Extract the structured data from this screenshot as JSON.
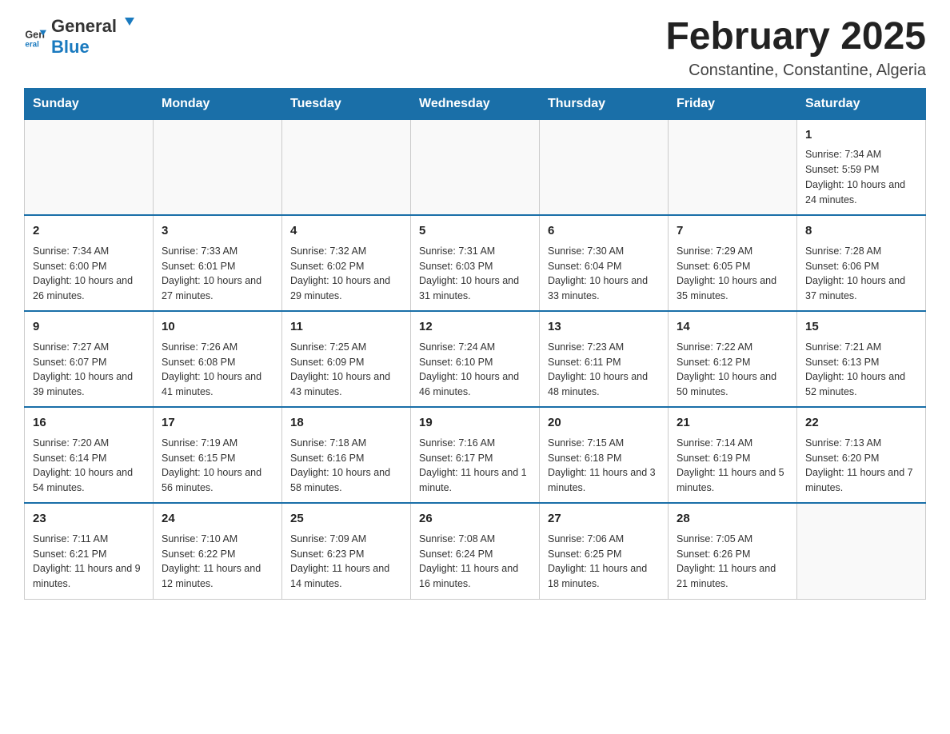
{
  "header": {
    "logo_general": "General",
    "logo_blue": "Blue",
    "month_year": "February 2025",
    "location": "Constantine, Constantine, Algeria"
  },
  "days_of_week": [
    "Sunday",
    "Monday",
    "Tuesday",
    "Wednesday",
    "Thursday",
    "Friday",
    "Saturday"
  ],
  "weeks": [
    [
      {
        "day": "",
        "info": ""
      },
      {
        "day": "",
        "info": ""
      },
      {
        "day": "",
        "info": ""
      },
      {
        "day": "",
        "info": ""
      },
      {
        "day": "",
        "info": ""
      },
      {
        "day": "",
        "info": ""
      },
      {
        "day": "1",
        "info": "Sunrise: 7:34 AM\nSunset: 5:59 PM\nDaylight: 10 hours and 24 minutes."
      }
    ],
    [
      {
        "day": "2",
        "info": "Sunrise: 7:34 AM\nSunset: 6:00 PM\nDaylight: 10 hours and 26 minutes."
      },
      {
        "day": "3",
        "info": "Sunrise: 7:33 AM\nSunset: 6:01 PM\nDaylight: 10 hours and 27 minutes."
      },
      {
        "day": "4",
        "info": "Sunrise: 7:32 AM\nSunset: 6:02 PM\nDaylight: 10 hours and 29 minutes."
      },
      {
        "day": "5",
        "info": "Sunrise: 7:31 AM\nSunset: 6:03 PM\nDaylight: 10 hours and 31 minutes."
      },
      {
        "day": "6",
        "info": "Sunrise: 7:30 AM\nSunset: 6:04 PM\nDaylight: 10 hours and 33 minutes."
      },
      {
        "day": "7",
        "info": "Sunrise: 7:29 AM\nSunset: 6:05 PM\nDaylight: 10 hours and 35 minutes."
      },
      {
        "day": "8",
        "info": "Sunrise: 7:28 AM\nSunset: 6:06 PM\nDaylight: 10 hours and 37 minutes."
      }
    ],
    [
      {
        "day": "9",
        "info": "Sunrise: 7:27 AM\nSunset: 6:07 PM\nDaylight: 10 hours and 39 minutes."
      },
      {
        "day": "10",
        "info": "Sunrise: 7:26 AM\nSunset: 6:08 PM\nDaylight: 10 hours and 41 minutes."
      },
      {
        "day": "11",
        "info": "Sunrise: 7:25 AM\nSunset: 6:09 PM\nDaylight: 10 hours and 43 minutes."
      },
      {
        "day": "12",
        "info": "Sunrise: 7:24 AM\nSunset: 6:10 PM\nDaylight: 10 hours and 46 minutes."
      },
      {
        "day": "13",
        "info": "Sunrise: 7:23 AM\nSunset: 6:11 PM\nDaylight: 10 hours and 48 minutes."
      },
      {
        "day": "14",
        "info": "Sunrise: 7:22 AM\nSunset: 6:12 PM\nDaylight: 10 hours and 50 minutes."
      },
      {
        "day": "15",
        "info": "Sunrise: 7:21 AM\nSunset: 6:13 PM\nDaylight: 10 hours and 52 minutes."
      }
    ],
    [
      {
        "day": "16",
        "info": "Sunrise: 7:20 AM\nSunset: 6:14 PM\nDaylight: 10 hours and 54 minutes."
      },
      {
        "day": "17",
        "info": "Sunrise: 7:19 AM\nSunset: 6:15 PM\nDaylight: 10 hours and 56 minutes."
      },
      {
        "day": "18",
        "info": "Sunrise: 7:18 AM\nSunset: 6:16 PM\nDaylight: 10 hours and 58 minutes."
      },
      {
        "day": "19",
        "info": "Sunrise: 7:16 AM\nSunset: 6:17 PM\nDaylight: 11 hours and 1 minute."
      },
      {
        "day": "20",
        "info": "Sunrise: 7:15 AM\nSunset: 6:18 PM\nDaylight: 11 hours and 3 minutes."
      },
      {
        "day": "21",
        "info": "Sunrise: 7:14 AM\nSunset: 6:19 PM\nDaylight: 11 hours and 5 minutes."
      },
      {
        "day": "22",
        "info": "Sunrise: 7:13 AM\nSunset: 6:20 PM\nDaylight: 11 hours and 7 minutes."
      }
    ],
    [
      {
        "day": "23",
        "info": "Sunrise: 7:11 AM\nSunset: 6:21 PM\nDaylight: 11 hours and 9 minutes."
      },
      {
        "day": "24",
        "info": "Sunrise: 7:10 AM\nSunset: 6:22 PM\nDaylight: 11 hours and 12 minutes."
      },
      {
        "day": "25",
        "info": "Sunrise: 7:09 AM\nSunset: 6:23 PM\nDaylight: 11 hours and 14 minutes."
      },
      {
        "day": "26",
        "info": "Sunrise: 7:08 AM\nSunset: 6:24 PM\nDaylight: 11 hours and 16 minutes."
      },
      {
        "day": "27",
        "info": "Sunrise: 7:06 AM\nSunset: 6:25 PM\nDaylight: 11 hours and 18 minutes."
      },
      {
        "day": "28",
        "info": "Sunrise: 7:05 AM\nSunset: 6:26 PM\nDaylight: 11 hours and 21 minutes."
      },
      {
        "day": "",
        "info": ""
      }
    ]
  ]
}
